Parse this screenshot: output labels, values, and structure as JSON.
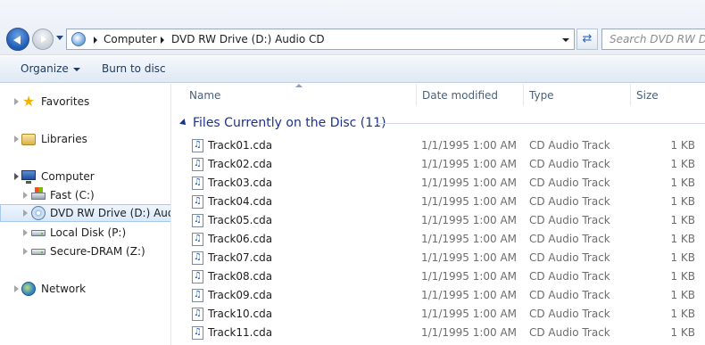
{
  "navigation": {
    "back_icon": "back-arrow-icon",
    "forward_icon": "forward-arrow-icon"
  },
  "address": {
    "crumbs": [
      "Computer",
      "DVD RW Drive (D:) Audio CD"
    ]
  },
  "search": {
    "placeholder": "Search DVD RW Drive"
  },
  "toolbar": {
    "organize_label": "Organize",
    "burn_label": "Burn to disc"
  },
  "sidebar": {
    "favorites": "Favorites",
    "libraries": "Libraries",
    "computer": "Computer",
    "drives": [
      {
        "label": "Fast (C:)",
        "icon": "windows-drive-icon"
      },
      {
        "label": "DVD RW Drive (D:) Audio CD",
        "icon": "dvd-drive-icon",
        "selected": true
      },
      {
        "label": "Local Disk (P:)",
        "icon": "hard-disk-icon"
      },
      {
        "label": "Secure-DRAM (Z:)",
        "icon": "hard-disk-icon"
      }
    ],
    "network": "Network"
  },
  "columns": {
    "name": "Name",
    "date": "Date modified",
    "type": "Type",
    "size": "Size"
  },
  "group": {
    "title": "Files Currently on the Disc (11)"
  },
  "files": [
    {
      "name": "Track01.cda",
      "date": "1/1/1995 1:00 AM",
      "type": "CD Audio Track",
      "size": "1 KB"
    },
    {
      "name": "Track02.cda",
      "date": "1/1/1995 1:00 AM",
      "type": "CD Audio Track",
      "size": "1 KB"
    },
    {
      "name": "Track03.cda",
      "date": "1/1/1995 1:00 AM",
      "type": "CD Audio Track",
      "size": "1 KB"
    },
    {
      "name": "Track04.cda",
      "date": "1/1/1995 1:00 AM",
      "type": "CD Audio Track",
      "size": "1 KB"
    },
    {
      "name": "Track05.cda",
      "date": "1/1/1995 1:00 AM",
      "type": "CD Audio Track",
      "size": "1 KB"
    },
    {
      "name": "Track06.cda",
      "date": "1/1/1995 1:00 AM",
      "type": "CD Audio Track",
      "size": "1 KB"
    },
    {
      "name": "Track07.cda",
      "date": "1/1/1995 1:00 AM",
      "type": "CD Audio Track",
      "size": "1 KB"
    },
    {
      "name": "Track08.cda",
      "date": "1/1/1995 1:00 AM",
      "type": "CD Audio Track",
      "size": "1 KB"
    },
    {
      "name": "Track09.cda",
      "date": "1/1/1995 1:00 AM",
      "type": "CD Audio Track",
      "size": "1 KB"
    },
    {
      "name": "Track10.cda",
      "date": "1/1/1995 1:00 AM",
      "type": "CD Audio Track",
      "size": "1 KB"
    },
    {
      "name": "Track11.cda",
      "date": "1/1/1995 1:00 AM",
      "type": "CD Audio Track",
      "size": "1 KB"
    }
  ]
}
